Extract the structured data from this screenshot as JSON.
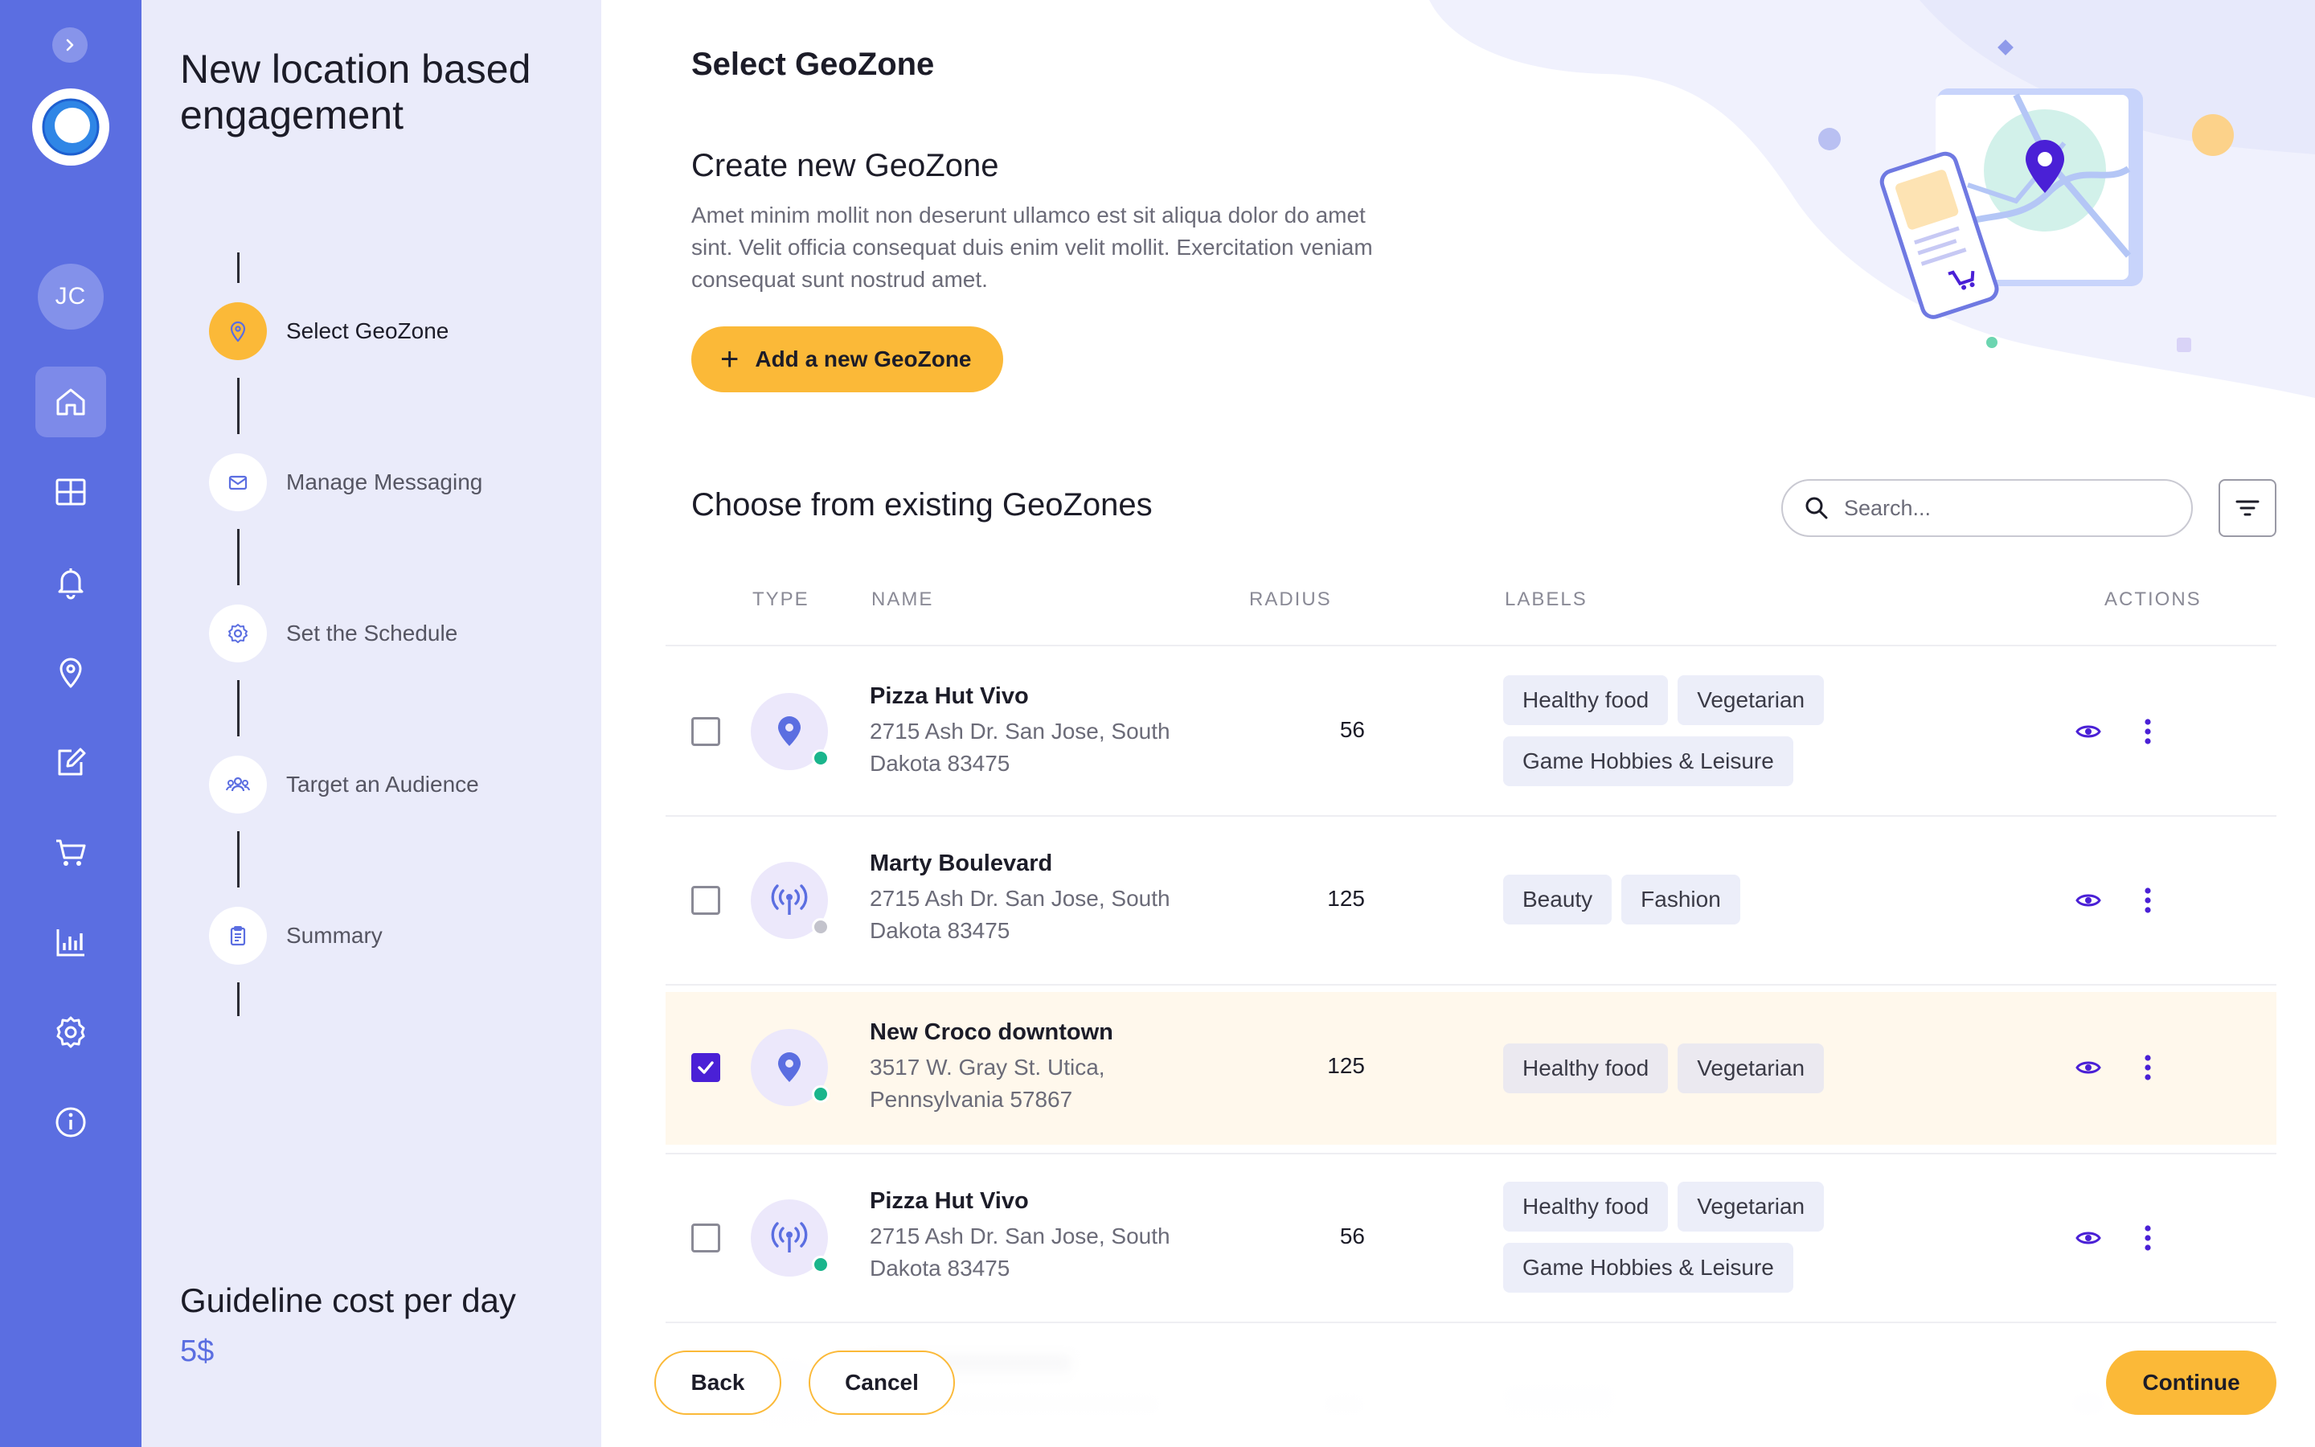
{
  "app": {
    "rail_user_initials": "JC",
    "collapse_icon": "chevron-right-icon"
  },
  "rail_nav": [
    {
      "icon": "home-icon",
      "active": true
    },
    {
      "icon": "grid-icon",
      "active": false
    },
    {
      "icon": "bell-icon",
      "active": false
    },
    {
      "icon": "map-pin-icon",
      "active": false
    },
    {
      "icon": "edit-icon",
      "active": false
    },
    {
      "icon": "cart-icon",
      "active": false
    },
    {
      "icon": "bar-chart-icon",
      "active": false
    },
    {
      "icon": "gear-icon",
      "active": false
    },
    {
      "icon": "info-icon",
      "active": false
    }
  ],
  "wizard": {
    "title": "New location based engagement",
    "steps": [
      {
        "label": "Select GeoZone",
        "icon": "map-pin-icon",
        "active": true
      },
      {
        "label": "Manage Messaging",
        "icon": "mail-icon",
        "active": false
      },
      {
        "label": "Set the Schedule",
        "icon": "gear-icon",
        "active": false
      },
      {
        "label": "Target an Audience",
        "icon": "people-icon",
        "active": false
      },
      {
        "label": "Summary",
        "icon": "clipboard-icon",
        "active": false
      }
    ],
    "cost_label": "Guideline cost per day",
    "cost_value": "5$"
  },
  "main": {
    "title": "Select GeoZone",
    "create_title": "Create new GeoZone",
    "create_description": "Amet minim mollit non deserunt ullamco est sit aliqua dolor do amet sint. Velit officia consequat duis enim velit mollit. Exercitation veniam consequat sunt nostrud amet.",
    "add_button": "Add a new GeoZone",
    "existing_title": "Choose from existing GeoZones",
    "search_placeholder": "Search...",
    "columns": {
      "type": "TYPE",
      "name": "NAME",
      "radius": "RADIUS",
      "labels": "LABELS",
      "actions": "ACTIONS"
    },
    "rows": [
      {
        "name": "Pizza Hut Vivo",
        "address": "2715 Ash Dr. San Jose, South Dakota 83475",
        "radius": "56",
        "labels": [
          "Healthy food",
          "Vegetarian",
          "Game Hobbies & Leisure"
        ],
        "type_icon": "map-pin-icon",
        "status": "active",
        "checked": false
      },
      {
        "name": "Marty Boulevard",
        "address": "2715 Ash Dr. San Jose, South Dakota 83475",
        "radius": "125",
        "labels": [
          "Beauty",
          "Fashion"
        ],
        "type_icon": "broadcast-icon",
        "status": "inactive",
        "checked": false
      },
      {
        "name": "New Croco downtown",
        "address": "3517 W. Gray St. Utica, Pennsylvania 57867",
        "radius": "125",
        "labels": [
          "Healthy food",
          "Vegetarian"
        ],
        "type_icon": "map-pin-icon",
        "status": "active",
        "checked": true
      },
      {
        "name": "Pizza Hut Vivo",
        "address": "2715 Ash Dr. San Jose, South Dakota 83475",
        "radius": "56",
        "labels": [
          "Healthy food",
          "Vegetarian",
          "Game Hobbies & Leisure"
        ],
        "type_icon": "broadcast-icon",
        "status": "active",
        "checked": false
      }
    ]
  },
  "footer": {
    "back": "Back",
    "cancel": "Cancel",
    "continue": "Continue"
  },
  "colors": {
    "rail": "#5b6ee1",
    "panel": "#eaebfa",
    "accent": "#fbb938",
    "primary": "#4a20d6",
    "selected_row": "#fff8ec",
    "status_active": "#1ab58c",
    "status_inactive": "#c3c3cc"
  }
}
